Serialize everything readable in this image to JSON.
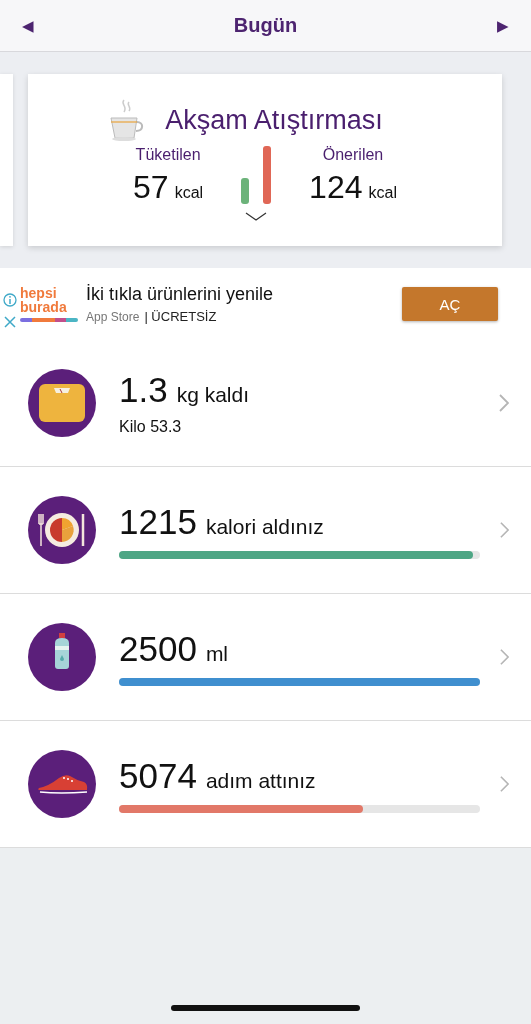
{
  "header": {
    "prev": "◀",
    "title": "Bugün",
    "next": "▶"
  },
  "meal_card": {
    "title": "Akşam Atıştırması",
    "consumed_label": "Tüketilen",
    "consumed_value": "57",
    "consumed_unit": "kcal",
    "recommended_label": "Önerilen",
    "recommended_value": "124",
    "recommended_unit": "kcal",
    "bars": [
      {
        "color": "#6cb37a"
      },
      {
        "color": "#e06756"
      }
    ]
  },
  "ad": {
    "brand_line1": "hepsi",
    "brand_line2": "burada",
    "headline": "İki tıkla ürünlerini yenile",
    "store": "App Store",
    "price": "| ÜCRETSİZ",
    "button": "AÇ"
  },
  "rows": [
    {
      "kind": "scale",
      "value": "1.3",
      "unit": "kg kaldı",
      "subtitle": "Kilo 53.3"
    },
    {
      "kind": "meal",
      "value": "1215",
      "unit": "kalori aldınız",
      "level": 0.98,
      "color": "#4ea685"
    },
    {
      "kind": "water",
      "value": "2500",
      "unit": "ml",
      "level": 1,
      "color": "#3f8fcf"
    },
    {
      "kind": "steps",
      "value": "5074",
      "unit": "adım attınız",
      "level": 0.675,
      "color": "#e27868"
    }
  ]
}
